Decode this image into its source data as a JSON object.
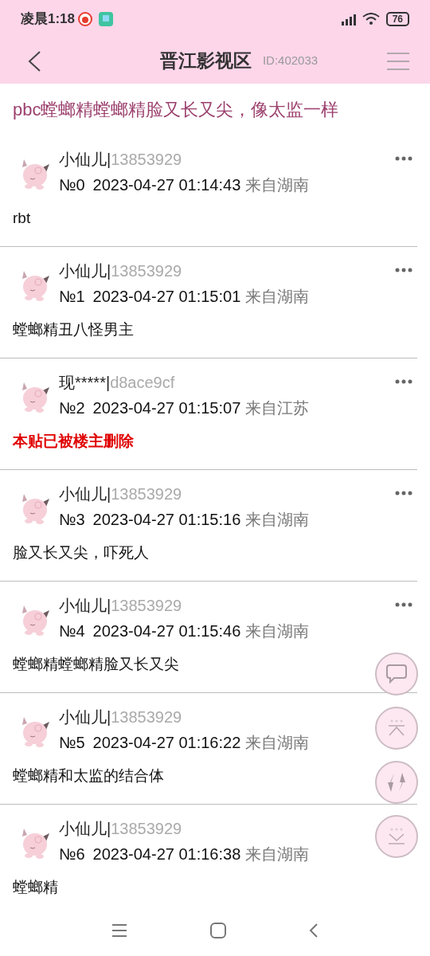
{
  "status_bar": {
    "time": "凌晨1:18",
    "battery": "76"
  },
  "header": {
    "title": "晋江影视区",
    "id": "ID:402033"
  },
  "thread_title": "pbc螳螂精螳螂精脸又长又尖，像太监一样",
  "posts": [
    {
      "name": "小仙儿|",
      "uid": "13853929",
      "floor": "№0",
      "time": "2023-04-27 01:14:43",
      "location": "来自湖南",
      "body": "rbt",
      "kind": "normal",
      "more_menu": true
    },
    {
      "name": "小仙儿|",
      "uid": "13853929",
      "floor": "№1",
      "time": "2023-04-27 01:15:01",
      "location": "来自湖南",
      "body": "螳螂精丑八怪男主",
      "kind": "normal",
      "more_menu": true
    },
    {
      "name": "现*****|",
      "uid": "d8ace9cf",
      "floor": "№2",
      "time": "2023-04-27 01:15:07",
      "location": "来自江苏",
      "body": "本贴已被楼主删除",
      "kind": "deleted",
      "more_menu": true
    },
    {
      "name": "小仙儿|",
      "uid": "13853929",
      "floor": "№3",
      "time": "2023-04-27 01:15:16",
      "location": "来自湖南",
      "body": "脸又长又尖，吓死人",
      "kind": "normal",
      "more_menu": true
    },
    {
      "name": "小仙儿|",
      "uid": "13853929",
      "floor": "№4",
      "time": "2023-04-27 01:15:46",
      "location": "来自湖南",
      "body": "螳螂精螳螂精脸又长又尖",
      "kind": "normal",
      "more_menu": true
    },
    {
      "name": "小仙儿|",
      "uid": "13853929",
      "floor": "№5",
      "time": "2023-04-27 01:16:22",
      "location": "来自湖南",
      "body": "螳螂精和太监的结合体",
      "kind": "normal",
      "more_menu": false
    },
    {
      "name": "小仙儿|",
      "uid": "13853929",
      "floor": "№6",
      "time": "2023-04-27 01:16:38",
      "location": "来自湖南",
      "body": "螳螂精",
      "kind": "normal",
      "more_menu": false
    }
  ]
}
